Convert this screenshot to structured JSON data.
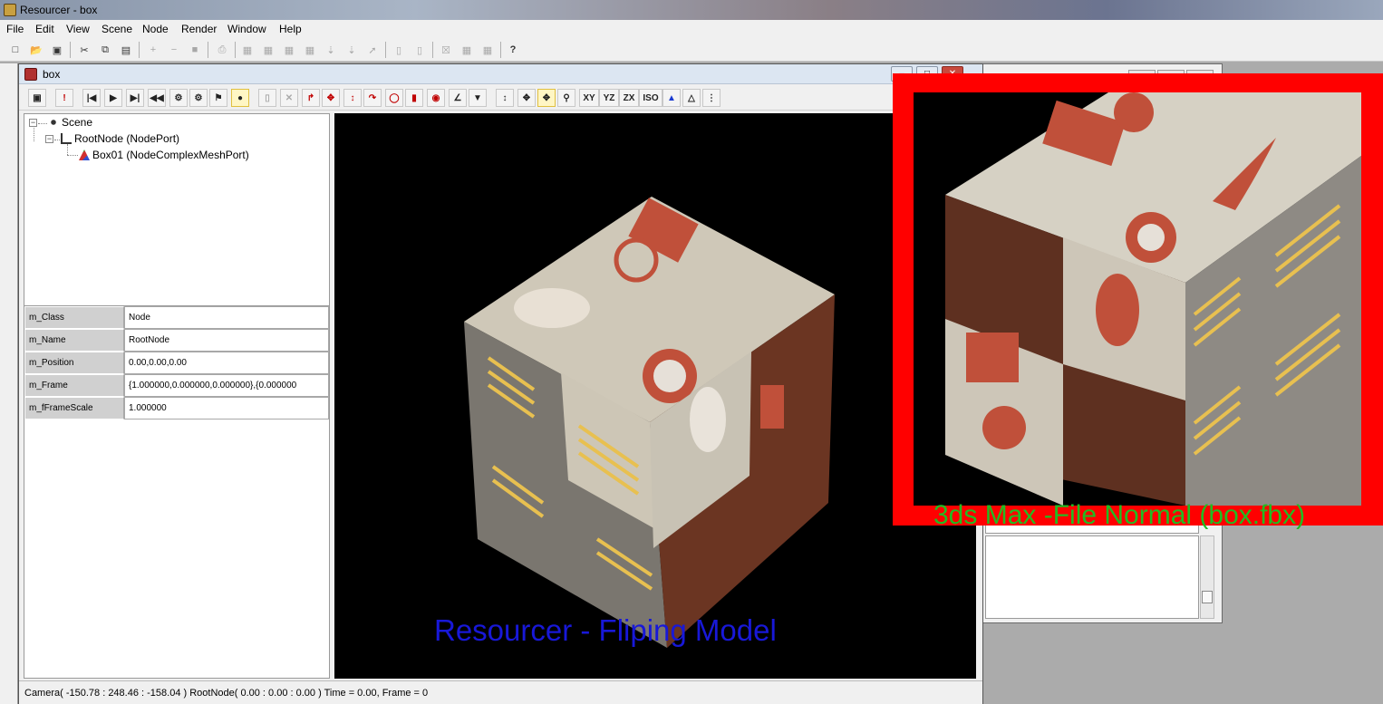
{
  "app": {
    "title": "Resourcer - box"
  },
  "menu": [
    "File",
    "Edit",
    "View",
    "Scene",
    "Node",
    "Render",
    "Window",
    "Help"
  ],
  "toolbar_icons": [
    "new-icon",
    "open-icon",
    "save-icon",
    "cut-icon",
    "copy-icon",
    "paste-icon",
    "add-icon",
    "remove-icon",
    "stop-icon",
    "print-icon",
    "export-icon",
    "help-icon"
  ],
  "document": {
    "title": "box",
    "toolbar": {
      "axis_xy": "XY",
      "axis_yz": "YZ",
      "axis_zx": "ZX",
      "axis_iso": "ISO"
    },
    "tree": {
      "scene": "Scene",
      "root": "RootNode (NodePort)",
      "child": "Box01 (NodeComplexMeshPort)"
    },
    "properties": [
      {
        "name": "m_Class",
        "value": "Node"
      },
      {
        "name": "m_Name",
        "value": "RootNode"
      },
      {
        "name": "m_Position",
        "value": "0.00,0.00,0.00"
      },
      {
        "name": "m_Frame",
        "value": "{1.000000,0.000000,0.000000},{0.000000"
      },
      {
        "name": "m_fFrameScale",
        "value": "1.000000"
      }
    ],
    "viewport_caption": "Resourcer - Fliping Model",
    "status": "Camera( -150.78 : 248.46 : -158.04 ) RootNode( 0.00 : 0.00 : 0.00 ) Time = 0.00, Frame = 0"
  },
  "overlay": {
    "caption": "3ds Max -File Normal (box.fbx)",
    "border_color": "#ff0000",
    "caption_color": "#22bb22"
  },
  "colors": {
    "viewport_bg": "#000000",
    "caption_blue": "#1818d8"
  }
}
